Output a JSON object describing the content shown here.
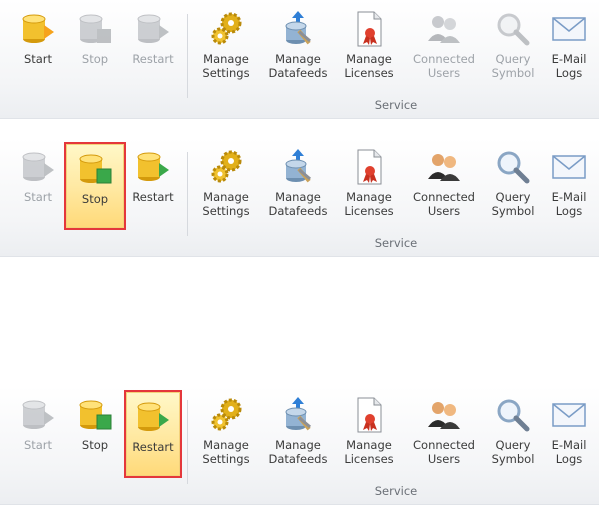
{
  "ribbons": [
    {
      "id": "r1",
      "active": "start",
      "buttons": {
        "start": {
          "label": "Start",
          "state": "active"
        },
        "stop": {
          "label": "Stop",
          "state": "disabled"
        },
        "restart": {
          "label": "Restart",
          "state": "disabled"
        },
        "manage_settings": {
          "label": "Manage\nSettings",
          "state": "enabled"
        },
        "manage_datafeeds": {
          "label": "Manage\nDatafeeds",
          "state": "enabled"
        },
        "manage_licenses": {
          "label": "Manage\nLicenses",
          "state": "enabled"
        },
        "connected_users": {
          "label": "Connected\nUsers",
          "state": "disabled"
        },
        "query_symbol": {
          "label": "Query\nSymbol",
          "state": "disabled"
        },
        "email_logs": {
          "label": "E-Mail\nLogs",
          "state": "enabled"
        }
      },
      "group_label": "Service"
    },
    {
      "id": "r2",
      "active": "stop",
      "buttons": {
        "start": {
          "label": "Start",
          "state": "disabled"
        },
        "stop": {
          "label": "Stop",
          "state": "active"
        },
        "restart": {
          "label": "Restart",
          "state": "enabled"
        },
        "manage_settings": {
          "label": "Manage\nSettings",
          "state": "enabled"
        },
        "manage_datafeeds": {
          "label": "Manage\nDatafeeds",
          "state": "enabled"
        },
        "manage_licenses": {
          "label": "Manage\nLicenses",
          "state": "enabled"
        },
        "connected_users": {
          "label": "Connected\nUsers",
          "state": "enabled"
        },
        "query_symbol": {
          "label": "Query\nSymbol",
          "state": "enabled"
        },
        "email_logs": {
          "label": "E-Mail\nLogs",
          "state": "enabled"
        }
      },
      "group_label": "Service"
    },
    {
      "id": "r3",
      "active": "restart",
      "buttons": {
        "start": {
          "label": "Start",
          "state": "disabled"
        },
        "stop": {
          "label": "Stop",
          "state": "enabled"
        },
        "restart": {
          "label": "Restart",
          "state": "active"
        },
        "manage_settings": {
          "label": "Manage\nSettings",
          "state": "enabled"
        },
        "manage_datafeeds": {
          "label": "Manage\nDatafeeds",
          "state": "enabled"
        },
        "manage_licenses": {
          "label": "Manage\nLicenses",
          "state": "enabled"
        },
        "connected_users": {
          "label": "Connected\nUsers",
          "state": "enabled"
        },
        "query_symbol": {
          "label": "Query\nSymbol",
          "state": "enabled"
        },
        "email_logs": {
          "label": "E-Mail\nLogs",
          "state": "enabled"
        }
      },
      "group_label": "Service"
    }
  ],
  "icons": {
    "start": "database-start-icon",
    "stop": "database-stop-icon",
    "restart": "database-restart-icon",
    "manage_settings": "gears-icon",
    "manage_datafeeds": "datafeed-tools-icon",
    "manage_licenses": "license-certificate-icon",
    "connected_users": "users-icon",
    "query_symbol": "magnifier-icon",
    "email_logs": "envelope-icon"
  },
  "colors": {
    "active_border": "#e4373b",
    "active_fill": "#ffe8a0",
    "database_yellow": "#f2c12e",
    "stop_green": "#3aa84a",
    "disabled_text": "#9da2a8"
  }
}
